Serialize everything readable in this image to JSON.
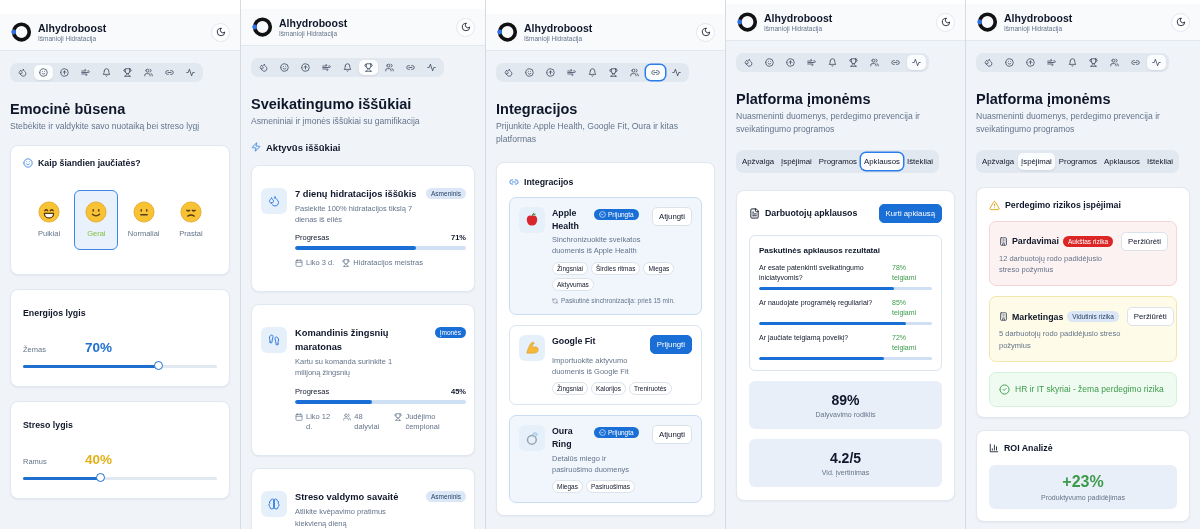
{
  "panels": [
    {
      "kind": "mood",
      "app": {
        "title": "Alhydroboost",
        "subtitle": "Išmanioji Hidratacija"
      },
      "nav": [
        {
          "selected": false,
          "focused": false
        },
        {
          "selected": true,
          "focused": false
        },
        {
          "selected": false,
          "focused": false
        },
        {
          "selected": false,
          "focused": false
        },
        {
          "selected": false,
          "focused": false
        },
        {
          "selected": false,
          "focused": false
        },
        {
          "selected": false,
          "focused": false
        },
        {
          "selected": false,
          "focused": false
        },
        {
          "selected": false,
          "focused": false
        }
      ],
      "title": "Emocinė būsena",
      "subtitle": "Stebėkite ir valdykite savo nuotaiką bei streso lygį",
      "mood_card": {
        "title": "Kaip šiandien jaučiatės?",
        "moods": [
          {
            "kind": "grin",
            "label": "Puikiai",
            "selected": false
          },
          {
            "kind": "smile",
            "label": "Gerai",
            "selected": true
          },
          {
            "kind": "neutral",
            "label": "Normaliai",
            "selected": false
          },
          {
            "kind": "sad",
            "label": "Prastai",
            "selected": false
          }
        ]
      },
      "sliders": [
        {
          "title": "Energijos lygis",
          "low_label": "Žemas",
          "reading": "70%",
          "level": 0.7,
          "color": "#1f6fd1"
        },
        {
          "title": "Streso lygis",
          "low_label": "Ramus",
          "reading": "40%",
          "level": 0.4,
          "color": "#e3b21a"
        }
      ]
    },
    {
      "kind": "challenges",
      "app": {
        "title": "Alhydroboost",
        "subtitle": "Išmanioji Hidratacija"
      },
      "nav": [
        {
          "selected": false,
          "focused": false
        },
        {
          "selected": false,
          "focused": false
        },
        {
          "selected": false,
          "focused": false
        },
        {
          "selected": false,
          "focused": false
        },
        {
          "selected": false,
          "focused": false
        },
        {
          "selected": true,
          "focused": false
        },
        {
          "selected": false,
          "focused": false
        },
        {
          "selected": false,
          "focused": false
        },
        {
          "selected": false,
          "focused": false
        }
      ],
      "title": "Sveikatingumo iššūkiai",
      "subtitle": "Asmeniniai ir įmonės iššūkiai su gamifikacija",
      "section": "Aktyvūs iššūkiai",
      "challenges": [
        {
          "kind": "hydration",
          "title": "7 dienų hidratacijos iššūkis",
          "badge": {
            "text": "Asmeninis",
            "kind": "personal"
          },
          "description": "Pasiekite 100% hidratacijos tikslą 7 dienas iš eilės",
          "progress_label": "Progresas",
          "progress_text": "71%",
          "level": 0.71,
          "meta": [
            {
              "kind": "calendar",
              "text": "Liko 3 d."
            },
            {
              "kind": "trophy",
              "text": "Hidratacijos meistras"
            }
          ]
        },
        {
          "kind": "steps",
          "title": "Komandinis žingsnių maratonas",
          "badge": {
            "text": "Įmonės",
            "kind": "company"
          },
          "description": "Kartu su komanda surinkite 1 milijoną žingsnių",
          "progress_label": "Progresas",
          "progress_text": "45%",
          "level": 0.45,
          "meta": [
            {
              "kind": "calendar",
              "text": "Liko 12 d."
            },
            {
              "kind": "users",
              "text": "48 dalyviai"
            },
            {
              "kind": "trophy",
              "text": "Judėjimo čempionai"
            }
          ]
        },
        {
          "kind": "stress",
          "title": "Streso valdymo savaitė",
          "badge": {
            "text": "Asmeninis",
            "kind": "personal"
          },
          "description": "Atlikite kvėpavimo pratimus kiekvieną dieną"
        }
      ]
    },
    {
      "kind": "integrations",
      "app": {
        "title": "Alhydroboost",
        "subtitle": "Išmanioji Hidratacija"
      },
      "nav": [
        {
          "selected": false,
          "focused": false
        },
        {
          "selected": false,
          "focused": false
        },
        {
          "selected": false,
          "focused": false
        },
        {
          "selected": false,
          "focused": false
        },
        {
          "selected": false,
          "focused": false
        },
        {
          "selected": false,
          "focused": false
        },
        {
          "selected": false,
          "focused": false
        },
        {
          "selected": true,
          "focused": true
        },
        {
          "selected": false,
          "focused": false
        }
      ],
      "title": "Integracijos",
      "subtitle": "Prijunkite Apple Health, Google Fit, Oura ir kitas platformas",
      "card_title": "Integracijos",
      "integrations": [
        {
          "kind": "apple",
          "name": "Apple Health",
          "connected": true,
          "status": "Prijungta",
          "button": "Atjungti",
          "description": "Sinchronizuokite sveikatos duomenis iš Apple Health",
          "tags": [
            "Žingsniai",
            "Širdies ritmas",
            "Miegas",
            "Aktyvumas"
          ],
          "sync": "Paskutinė sinchronizacija: prieš 15 min."
        },
        {
          "kind": "fit",
          "name": "Google Fit",
          "connected": false,
          "button": "Prijungti",
          "description": "Importuokite aktyvumo duomenis iš Google Fit",
          "tags": [
            "Žingsniai",
            "Kalorijos",
            "Treniruotės"
          ]
        },
        {
          "kind": "ring",
          "name": "Oura Ring",
          "connected": true,
          "status": "Prijungta",
          "button": "Atjungti",
          "description": "Detalūs miego ir pasiruošimo duomenys",
          "tags": [
            "Miegas",
            "Pasiruošimas"
          ]
        }
      ]
    },
    {
      "kind": "corporate",
      "app": {
        "title": "Alhydroboost",
        "subtitle": "Išmanioji Hidratacija"
      },
      "nav": [
        {
          "selected": false,
          "focused": false
        },
        {
          "selected": false,
          "focused": false
        },
        {
          "selected": false,
          "focused": false
        },
        {
          "selected": false,
          "focused": false
        },
        {
          "selected": false,
          "focused": false
        },
        {
          "selected": false,
          "focused": false
        },
        {
          "selected": false,
          "focused": false
        },
        {
          "selected": false,
          "focused": false
        },
        {
          "selected": true,
          "focused": false
        }
      ],
      "title": "Platforma įmonėms",
      "subtitle": "Nuasmeninti duomenys, perdegimo prevencija ir sveikatingumo programos",
      "tabs": [
        {
          "label": "Apžvalga",
          "selected": false,
          "focused": false
        },
        {
          "label": "Įspėjimai",
          "selected": false,
          "focused": false
        },
        {
          "label": "Programos",
          "selected": false,
          "focused": false
        },
        {
          "label": "Apklausos",
          "selected": true,
          "focused": true
        },
        {
          "label": "Ištekliai",
          "selected": false,
          "focused": false
        }
      ],
      "section": {
        "kind": "surveys",
        "title": "Darbuotojų apklausos",
        "button": "Kurti apklausą",
        "results_title": "Paskutinės apklausos rezultatai",
        "questions": [
          {
            "text": "Ar esate patenkinti sveikatingumo iniciatyvomis?",
            "result": "78% teigiami",
            "level": 0.78
          },
          {
            "text": "Ar naudojate programėlę reguliariai?",
            "result": "85% teigiami",
            "level": 0.85
          },
          {
            "text": "Ar jaučiate teigiamą poveikį?",
            "result": "72% teigiami",
            "level": 0.72
          }
        ],
        "stats": [
          {
            "value": "89%",
            "label": "Dalyvavimo rodiklis"
          },
          {
            "value": "4.2/5",
            "label": "Vid. įvertinimas"
          }
        ]
      }
    },
    {
      "kind": "corporate",
      "app": {
        "title": "Alhydroboost",
        "subtitle": "Išmanioji Hidratacija"
      },
      "nav": [
        {
          "selected": false,
          "focused": false
        },
        {
          "selected": false,
          "focused": false
        },
        {
          "selected": false,
          "focused": false
        },
        {
          "selected": false,
          "focused": false
        },
        {
          "selected": false,
          "focused": false
        },
        {
          "selected": false,
          "focused": false
        },
        {
          "selected": false,
          "focused": false
        },
        {
          "selected": false,
          "focused": false
        },
        {
          "selected": true,
          "focused": false
        }
      ],
      "title": "Platforma įmonėms",
      "subtitle": "Nuasmeninti duomenys, perdegimo prevencija ir sveikatingumo programos",
      "tabs": [
        {
          "label": "Apžvalga",
          "selected": false,
          "focused": false
        },
        {
          "label": "Įspėjimai",
          "selected": true,
          "focused": false
        },
        {
          "label": "Programos",
          "selected": false,
          "focused": false
        },
        {
          "label": "Apklausos",
          "selected": false,
          "focused": false
        },
        {
          "label": "Ištekliai",
          "selected": false,
          "focused": false
        }
      ],
      "section": {
        "kind": "alerts",
        "title": "Perdegimo rizikos įspėjimai",
        "alerts": [
          {
            "kind": "high",
            "department": "Pardavimai",
            "badge": "Aukštas rizika",
            "button": "Peržiūrėti",
            "text": "12 darbuotojų rodo padidėjusio streso požymius"
          },
          {
            "kind": "medium",
            "department": "Marketingas",
            "badge": "Vidutinis rizika",
            "button": "Peržiūrėti",
            "text": "5 darbuotojų rodo padidėjusio streso požymius"
          },
          {
            "kind": "low",
            "text": "HR ir IT skyriai - žema perdegimo rizika"
          }
        ],
        "roi": {
          "title": "ROI Analizė",
          "value": "+23%",
          "label": "Produktyvumo padidėjimas"
        }
      }
    }
  ]
}
